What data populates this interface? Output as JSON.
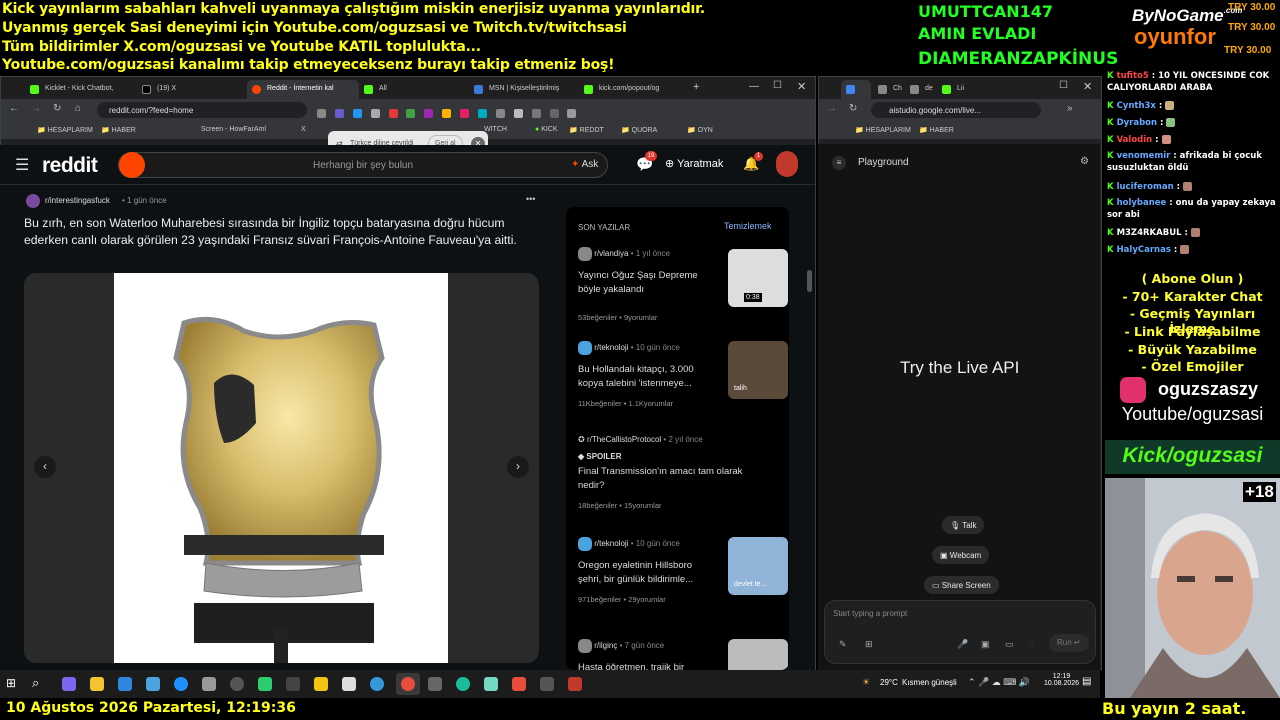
{
  "overlay": {
    "lines": [
      "Kick yayınlarım sabahları kahveli uyanmaya çalıştığım miskin enerjisiz uyanma yayınlarıdır.",
      "Uyanmış gerçek Sasi deneyimi için Youtube.com/oguzsasi ve Twitch.tv/twitchsasi",
      "Tüm bildirimler X.com/oguzsasi ve Youtube KATIL toplulukta...",
      "Youtube.com/oguzsasi kanalımı takip etmeyeceksenz burayı takip etmeniz boş!"
    ],
    "names": [
      "UMUTTCAN147",
      "AMIN EVLADI",
      "DIAMERANZAPKİNUS"
    ],
    "logo_top": "ByNoGame",
    "logo_com": ".com",
    "logo_bottom": "oyunfor",
    "try_values": [
      "TRY 30.00",
      "TRY 30.00",
      "TRY 30.00"
    ]
  },
  "left_browser": {
    "tabs": [
      "Kicklet - Kick Chatbot,",
      "(19) X",
      "Reddit - İnternetin kal",
      "All",
      "MSN | Kişiselleştirilmiş",
      "kick.com/popout/og"
    ],
    "url": "reddit.com/?feed=home",
    "bookmarks": [
      "HESAPLARIM",
      "HABER",
      "Screen - HowFarAml",
      "X",
      "WITCH",
      "KICK",
      "REDDT",
      "QUORA",
      "OYN"
    ],
    "translate_popup": {
      "text": "Türkçe diline çevrildi",
      "button": "Geri al"
    }
  },
  "reddit": {
    "logo": "reddit",
    "search_placeholder": "Herhangi bir şey bulun",
    "ask": "Ask",
    "create": "Yaratmak",
    "chat_badge": "19",
    "notif_badge": "1",
    "post": {
      "subreddit": "r/interestingasfuck",
      "time": "1 gün önce",
      "title": "Bu zırh, en son Waterloo Muharebesi sırasında bir İngiliz topçu bataryasına doğru hücum ederken canlı olarak görülen 23 yaşındaki Fransız süvari François-Antoine Fauveau'ya aitti.",
      "more": "•••"
    },
    "sidebar": {
      "heading": "SON YAZILAR",
      "clear": "Temizlemek",
      "items": [
        {
          "sub": "r/vlandiya",
          "time": "1 yıl önce",
          "title": "Yayıncı Oğuz Şaşı Depreme böyle yakalandı",
          "likes": "53beğeniler",
          "comments": "9yorumlar",
          "thumb_label": "0:38"
        },
        {
          "sub": "r/teknoloji",
          "time": "10 gün önce",
          "title": "Bu Hollandalı kitapçı, 3.000 kopya talebini 'istenmeye...",
          "likes": "11Kbeğeniler",
          "comments": "1.1Kyorumlar",
          "thumb_label": "talih"
        },
        {
          "sub": "r/TheCallistoProtocol",
          "time": "2 yıl önce",
          "spoiler": "SPOILER",
          "title": "Final Transmission'ın amacı tam olarak nedir?",
          "likes": "18beğeniler",
          "comments": "15yorumlar"
        },
        {
          "sub": "r/teknoloji",
          "time": "10 gün önce",
          "title": "Oregon eyaletinin Hillsboro şehri, bir günlük bildirimle...",
          "likes": "971beğeniler",
          "comments": "29yorumlar",
          "thumb_label": "devlet te..."
        },
        {
          "sub": "r/ilginç",
          "time": "7 gün önce",
          "title": "Hasta öğretmen, trajik bir"
        }
      ]
    }
  },
  "right_browser": {
    "url": "aistudio.google.com/live...",
    "bookmarks": [
      "HESAPLARIM",
      "HABER"
    ],
    "tabs": [
      "Ch",
      "de",
      "Lii"
    ]
  },
  "ai_studio": {
    "title": "Playground",
    "center": "Try the Live API",
    "talk": "Talk",
    "webcam": "Webcam",
    "share": "Share Screen",
    "prompt_placeholder": "Start typing a prompt",
    "run": "Run"
  },
  "chat": [
    {
      "user": "tufito5",
      "color": "#ff4444",
      "text": "10 YIL ONCESINDE COK CALIYORLARDI ARABA"
    },
    {
      "user": "Cynth3x",
      "color": "#66aaff",
      "text": ""
    },
    {
      "user": "Dyrabon",
      "color": "#66aaff",
      "text": ""
    },
    {
      "user": "Valodin",
      "color": "#ff4444",
      "text": ""
    },
    {
      "user": "venomemir",
      "color": "#66aaff",
      "text": "afrikada bi çocuk susuzluktan öldü"
    },
    {
      "user": "luciferoman",
      "color": "#66aaff",
      "text": ""
    },
    {
      "user": "holybanee",
      "color": "#66aaff",
      "text": "onu da yapay zekaya sor abi"
    },
    {
      "user": "M3Z4RKABUL",
      "color": "#ffffff",
      "text": ""
    },
    {
      "user": "HalyCarnas",
      "color": "#66aaff",
      "text": ""
    }
  ],
  "promo": [
    "( Abone Olun )",
    "- 70+ Karakter Chat",
    "- Geçmiş Yayınları İzleme",
    "- Link Paylaşabilme",
    "- Büyük Yazabilme",
    "- Özel Emojiler"
  ],
  "social": {
    "insta": "oguzszaszy",
    "youtube": "Youtube/oguzsasi",
    "kick": "Kick/oguzsasi",
    "age": "+18"
  },
  "taskbar": {
    "weather_temp": "29°C",
    "weather_text": "Kısmen güneşli",
    "time": "12:19",
    "date": "10.08.2026"
  },
  "bottom": {
    "datetime": "10 Ağustos 2026 Pazartesi, 12:19:36",
    "duration": "Bu yayın 2 saat."
  }
}
